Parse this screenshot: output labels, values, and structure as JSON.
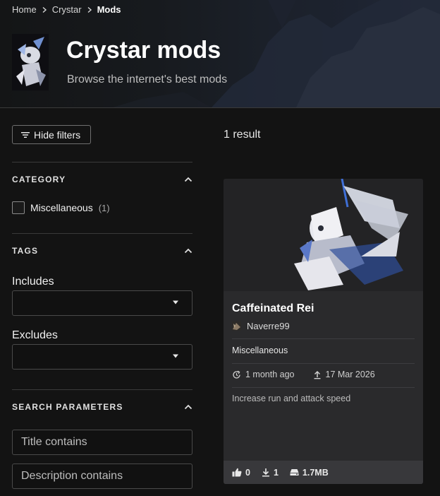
{
  "breadcrumb": {
    "items": [
      {
        "label": "Home"
      },
      {
        "label": "Crystar"
      },
      {
        "label": "Mods"
      }
    ]
  },
  "header": {
    "title": "Crystar mods",
    "subtitle": "Browse the internet's best mods"
  },
  "toolbar": {
    "hide_filters_label": "Hide filters",
    "result_count": "1 result"
  },
  "filters": {
    "category": {
      "title": "CATEGORY",
      "options": [
        {
          "label": "Miscellaneous",
          "count": "(1)",
          "checked": false
        }
      ]
    },
    "tags": {
      "title": "TAGS",
      "includes_label": "Includes",
      "includes_value": "",
      "excludes_label": "Excludes",
      "excludes_value": ""
    },
    "search": {
      "title": "SEARCH PARAMETERS",
      "title_placeholder": "Title contains",
      "description_placeholder": "Description contains"
    }
  },
  "mods": [
    {
      "title": "Caffeinated Rei",
      "author": "Naverre99",
      "category": "Miscellaneous",
      "updated": "1 month ago",
      "uploaded": "17 Mar 2026",
      "description": "Increase run and attack speed",
      "endorsements": "0",
      "downloads": "1",
      "size": "1.7MB"
    }
  ],
  "icons": {
    "breadcrumb_separator": "chevron-right-icon",
    "filter": "filter-lines-icon",
    "collapse": "chevron-up-icon",
    "dropdown": "caret-down-icon",
    "updated": "refresh-clock-icon",
    "uploaded": "upload-arrow-icon",
    "endorse": "thumbs-up-icon",
    "download": "download-icon",
    "size": "drive-icon"
  },
  "colors": {
    "background": "#131313",
    "card": "#2a2a2c",
    "card_footer": "#38383b",
    "border": "#4a4a4a",
    "text": "#e8e8e8"
  }
}
